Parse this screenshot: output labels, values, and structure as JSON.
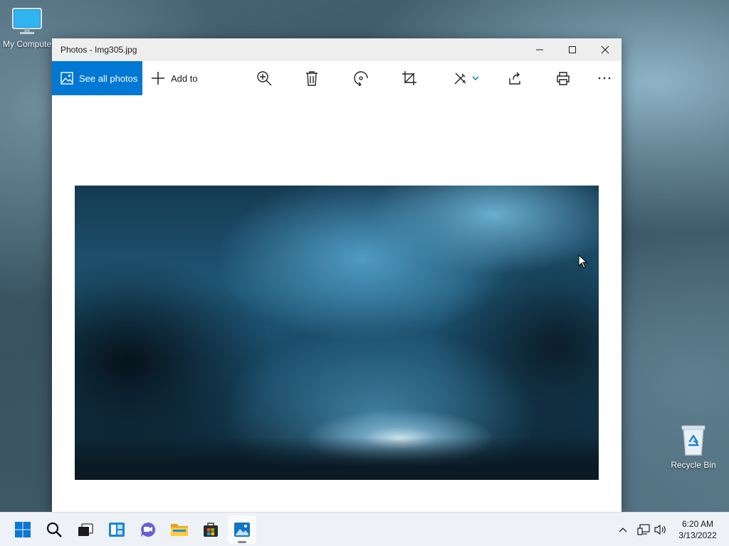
{
  "desktop": {
    "icons": [
      {
        "label": "My Compute"
      },
      {
        "label": "Recycle Bin"
      }
    ]
  },
  "window": {
    "title": "Photos - Img305.jpg",
    "toolbar": {
      "see_all_label": "See all photos",
      "add_to_label": "Add to"
    }
  },
  "taskbar": {
    "time": "6:20 AM",
    "date": "3/13/2022"
  },
  "colors": {
    "accent": "#0078d4"
  }
}
